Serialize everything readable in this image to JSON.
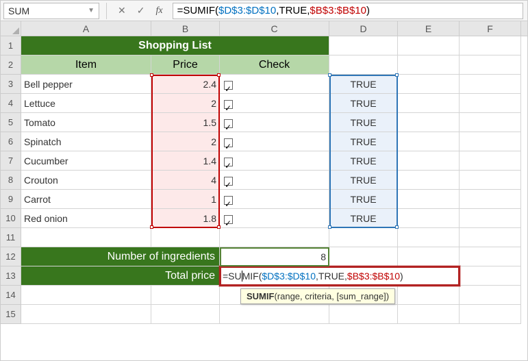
{
  "namebox": {
    "value": "SUM"
  },
  "formula_bar": {
    "prefix": "=SUMIF(",
    "range1": "$D$3:$D$10",
    "sep1": ",TRUE,",
    "range2": "$B$3:$B$10",
    "suffix": ")"
  },
  "columns": [
    "A",
    "B",
    "C",
    "D",
    "E",
    "F"
  ],
  "title": "Shopping List",
  "headers": {
    "item": "Item",
    "price": "Price",
    "check": "Check"
  },
  "items": [
    {
      "name": "Bell pepper",
      "price": "2.4",
      "checked": true,
      "truth": "TRUE"
    },
    {
      "name": "Lettuce",
      "price": "2",
      "checked": true,
      "truth": "TRUE"
    },
    {
      "name": "Tomato",
      "price": "1.5",
      "checked": true,
      "truth": "TRUE"
    },
    {
      "name": "Spinatch",
      "price": "2",
      "checked": true,
      "truth": "TRUE"
    },
    {
      "name": "Cucumber",
      "price": "1.4",
      "checked": true,
      "truth": "TRUE"
    },
    {
      "name": "Crouton",
      "price": "4",
      "checked": true,
      "truth": "TRUE"
    },
    {
      "name": "Carrot",
      "price": "1",
      "checked": true,
      "truth": "TRUE"
    },
    {
      "name": "Red onion",
      "price": "1.8",
      "checked": true,
      "truth": "TRUE"
    }
  ],
  "summary": {
    "num_label": "Number of ingredients",
    "num_value": "8",
    "price_label": "Total price"
  },
  "active_cell": {
    "pre": "=SU",
    "mid": "MIF(",
    "range1": "$D$3:$D$10",
    "sep1": ",TRUE,",
    "range2": "$B$3:$B$10",
    "suffix": ")"
  },
  "tooltip": {
    "fn": "SUMIF",
    "args": "(range, criteria, [sum_range])"
  },
  "chart_data": {
    "type": "table",
    "title": "Shopping List",
    "columns": [
      "Item",
      "Price",
      "Check",
      "D"
    ],
    "rows": [
      [
        "Bell pepper",
        2.4,
        true,
        "TRUE"
      ],
      [
        "Lettuce",
        2,
        true,
        "TRUE"
      ],
      [
        "Tomato",
        1.5,
        true,
        "TRUE"
      ],
      [
        "Spinatch",
        2,
        true,
        "TRUE"
      ],
      [
        "Cucumber",
        1.4,
        true,
        "TRUE"
      ],
      [
        "Crouton",
        4,
        true,
        "TRUE"
      ],
      [
        "Carrot",
        1,
        true,
        "TRUE"
      ],
      [
        "Red onion",
        1.8,
        true,
        "TRUE"
      ]
    ],
    "summary": {
      "Number of ingredients": 8,
      "Total price formula": "=SUMIF($D$3:$D$10,TRUE,$B$3:$B$10)"
    }
  }
}
